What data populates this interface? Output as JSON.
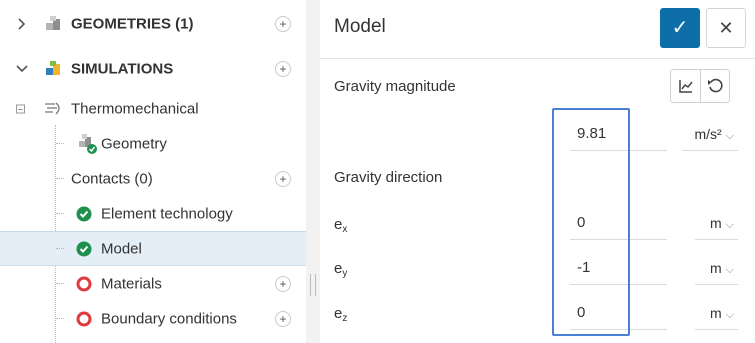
{
  "tree": {
    "geometries": {
      "label": "GEOMETRIES (1)",
      "icon": "cube-gray-icon"
    },
    "simulations": {
      "label": "SIMULATIONS",
      "icon": "cube-color-icon"
    },
    "simulation": {
      "label": "Thermomechanical",
      "icon": "thermomechanical-icon"
    },
    "children": [
      {
        "label": "Geometry",
        "status": "geometry-valid-icon"
      },
      {
        "label": "Contacts (0)",
        "status": "none"
      },
      {
        "label": "Element technology",
        "status": "check"
      },
      {
        "label": "Model",
        "status": "check"
      },
      {
        "label": "Materials",
        "status": "error"
      },
      {
        "label": "Boundary conditions",
        "status": "error"
      }
    ],
    "plus_symbol": "+",
    "collapse_symbol": "−"
  },
  "panel": {
    "title": "Model",
    "ok_symbol": "✓",
    "close_symbol": "✕",
    "gravity_magnitude": {
      "label": "Gravity magnitude",
      "value": "9.81",
      "unit": "m/s²"
    },
    "gravity_direction": {
      "label": "Gravity direction"
    },
    "components": [
      {
        "base": "e",
        "sub": "x",
        "value": "0",
        "unit": "m"
      },
      {
        "base": "e",
        "sub": "y",
        "value": "-1",
        "unit": "m"
      },
      {
        "base": "e",
        "sub": "z",
        "value": "0",
        "unit": "m"
      }
    ]
  },
  "colors": {
    "accent": "#0e6fa8",
    "selected_row": "#e3eef6",
    "check_green": "#1f8f4e",
    "error_red": "#e0393e",
    "highlight_box": "#4a7fd4"
  }
}
